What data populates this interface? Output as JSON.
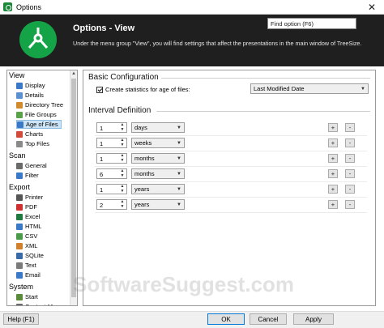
{
  "window": {
    "title": "Options",
    "close_glyph": "✕"
  },
  "header": {
    "title": "Options - View",
    "description": "Under the menu group \"View\", you will find settings that affect the presentations in the main window of TreeSize.",
    "find_placeholder": "Find option (F6)"
  },
  "sidebar": {
    "groups": [
      {
        "label": "View",
        "items": [
          {
            "label": "Display",
            "icon": "display-icon",
            "color": "#3a78c8"
          },
          {
            "label": "Details",
            "icon": "details-icon",
            "color": "#5a8fd0"
          },
          {
            "label": "Directory Tree",
            "icon": "tree-icon",
            "color": "#d28b2c"
          },
          {
            "label": "File Groups",
            "icon": "file-groups-icon",
            "color": "#5aa24a"
          },
          {
            "label": "Age of Files",
            "icon": "age-icon",
            "color": "#3a78c8"
          },
          {
            "label": "Charts",
            "icon": "chart-icon",
            "color": "#d24a3a"
          },
          {
            "label": "Top Files",
            "icon": "top-files-icon",
            "color": "#8a8a8a"
          }
        ]
      },
      {
        "label": "Scan",
        "items": [
          {
            "label": "General",
            "icon": "gear-icon",
            "color": "#6a6a6a"
          },
          {
            "label": "Filter",
            "icon": "filter-icon",
            "color": "#3a78c8"
          }
        ]
      },
      {
        "label": "Export",
        "items": [
          {
            "label": "Printer",
            "icon": "printer-icon",
            "color": "#555555"
          },
          {
            "label": "PDF",
            "icon": "pdf-icon",
            "color": "#d03030"
          },
          {
            "label": "Excel",
            "icon": "excel-icon",
            "color": "#1e7a40"
          },
          {
            "label": "HTML",
            "icon": "html-icon",
            "color": "#3a78c8"
          },
          {
            "label": "CSV",
            "icon": "csv-icon",
            "color": "#4a9a4a"
          },
          {
            "label": "XML",
            "icon": "xml-icon",
            "color": "#d2802c"
          },
          {
            "label": "SQLite",
            "icon": "sqlite-icon",
            "color": "#3a6aa8"
          },
          {
            "label": "Text",
            "icon": "text-icon",
            "color": "#7a7a7a"
          },
          {
            "label": "Email",
            "icon": "email-icon",
            "color": "#3a78c8"
          }
        ]
      },
      {
        "label": "System",
        "items": [
          {
            "label": "Start",
            "icon": "start-icon",
            "color": "#5a8a3a"
          },
          {
            "label": "Context Menu",
            "icon": "context-menu-icon",
            "color": "#6a6a6a"
          }
        ]
      }
    ],
    "selected": "Age of Files"
  },
  "basic": {
    "title": "Basic Configuration",
    "checkbox_label": "Create statistics for age of files:",
    "checked": true,
    "mode_value": "Last Modified Date"
  },
  "interval": {
    "title": "Interval Definition",
    "rows": [
      {
        "count": "1",
        "unit": "days"
      },
      {
        "count": "1",
        "unit": "weeks"
      },
      {
        "count": "1",
        "unit": "months"
      },
      {
        "count": "6",
        "unit": "months"
      },
      {
        "count": "1",
        "unit": "years"
      },
      {
        "count": "2",
        "unit": "years"
      }
    ],
    "plus": "+",
    "minus": "-"
  },
  "footer": {
    "help": "Help (F1)",
    "ok": "OK",
    "cancel": "Cancel",
    "apply": "Apply"
  },
  "watermark": "SoftwareSuggest.com"
}
